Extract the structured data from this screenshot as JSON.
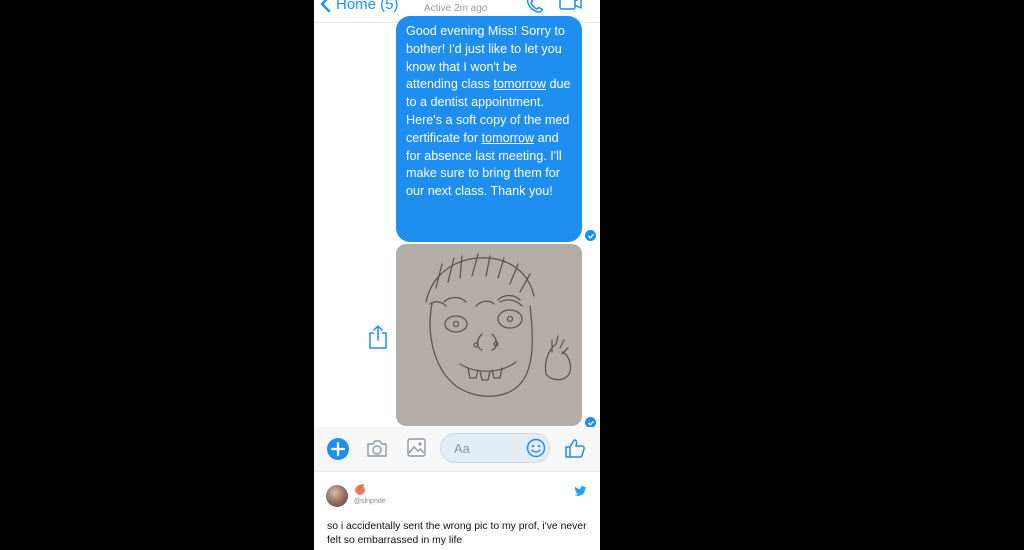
{
  "header": {
    "back_label": "Home (5)",
    "status": "Active 2m ago"
  },
  "message": {
    "segments": [
      "Good evening Miss! Sorry to bother! I'd just like to let you know that I won't be attending class ",
      "tomorrow",
      " due to a dentist appointment. Here's a soft copy of the med certificate for ",
      "tomorrow",
      " and for absence last meeting. I'll make sure to bring them for our next class. Thank you!"
    ]
  },
  "composer": {
    "placeholder": "Aa"
  },
  "tweet": {
    "handle": "@slnpnde",
    "emoji": "peach",
    "text": "so i accidentally sent the wrong pic to my prof, i've never felt so embarrassed in my life"
  },
  "colors": {
    "accent": "#1f8ef1",
    "twitter": "#1da1f2",
    "backdrop": "#000000"
  },
  "icons": [
    "chevron-left-icon",
    "phone-icon",
    "video-camera-icon",
    "share-icon",
    "plus-icon",
    "camera-icon",
    "image-icon",
    "emoji-icon",
    "thumbs-up-icon",
    "check-icon",
    "twitter-bird-icon"
  ]
}
